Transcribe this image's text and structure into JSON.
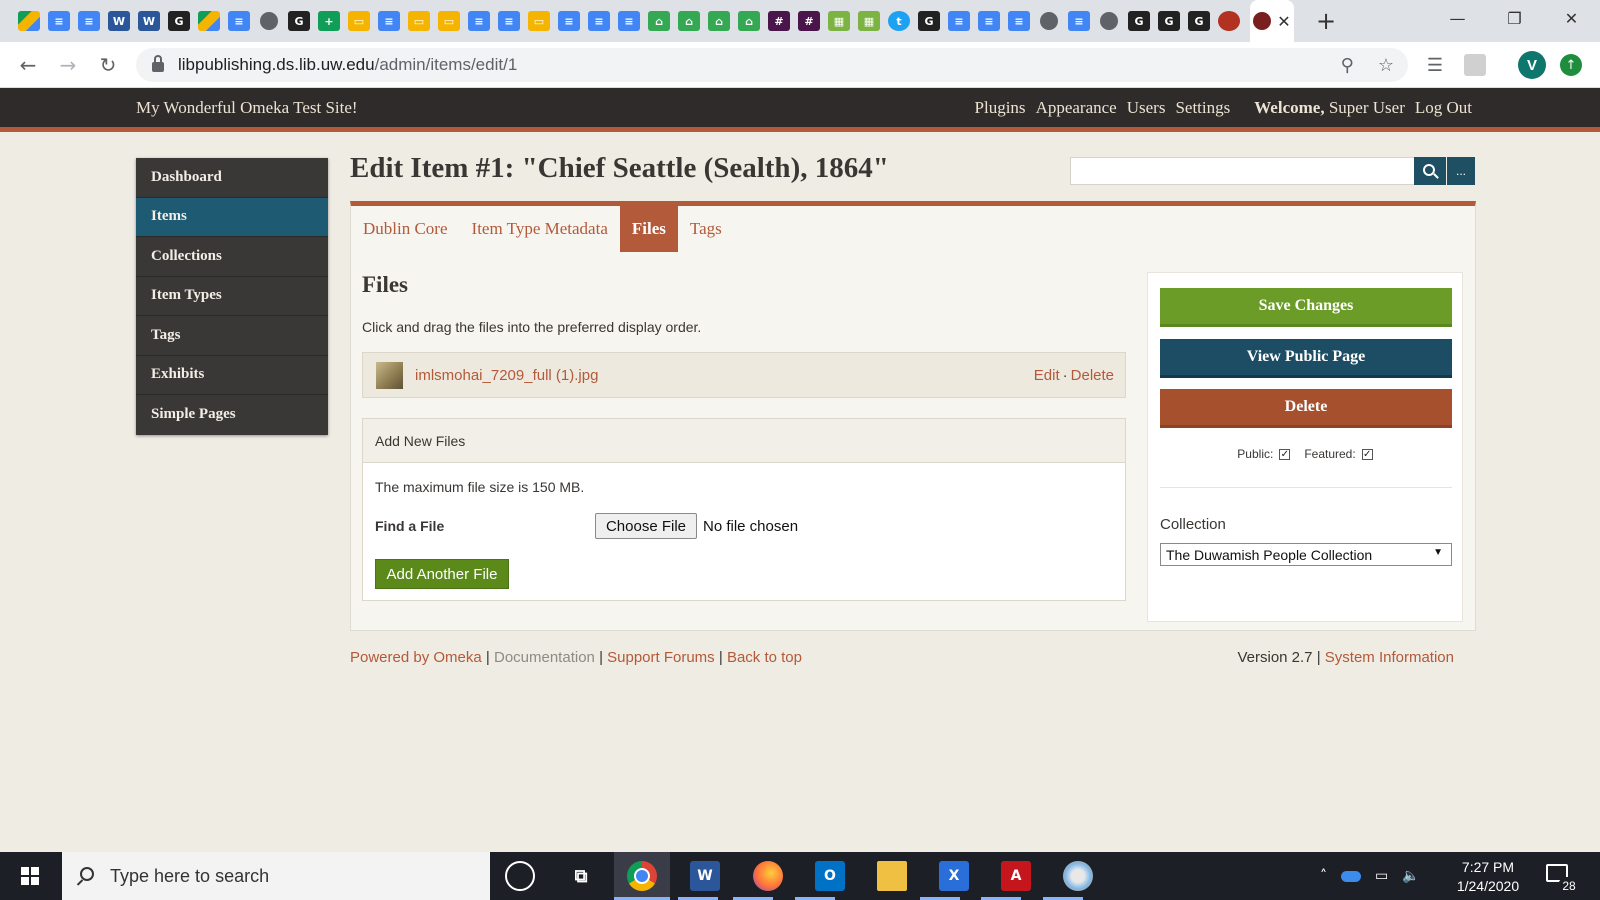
{
  "browser": {
    "address_domain": "libpublishing.ds.lib.uw.edu",
    "address_path": "/admin/items/edit/1",
    "profile_initial": "V",
    "pinned_tabs": [
      "drive",
      "doc",
      "doc",
      "word",
      "word",
      "dark",
      "drive",
      "doc",
      "globe",
      "dark",
      "sheet",
      "slide",
      "doc",
      "slide",
      "slide",
      "doc",
      "doc",
      "slide",
      "doc",
      "doc",
      "doc",
      "map",
      "map",
      "map",
      "map",
      "slack",
      "slack",
      "cal",
      "cal",
      "tw",
      "dark",
      "doc",
      "doc",
      "doc",
      "globe",
      "doc",
      "globe",
      "dark",
      "dark",
      "dark",
      "red"
    ]
  },
  "header": {
    "site_title": "My Wonderful Omeka Test Site!",
    "nav": [
      "Plugins",
      "Appearance",
      "Users",
      "Settings"
    ],
    "welcome_bold": "Welcome,",
    "user_name": "Super User",
    "logout": "Log Out"
  },
  "sidebar": {
    "items": [
      {
        "label": "Dashboard"
      },
      {
        "label": "Items"
      },
      {
        "label": "Collections"
      },
      {
        "label": "Item Types"
      },
      {
        "label": "Tags"
      },
      {
        "label": "Exhibits"
      },
      {
        "label": "Simple Pages"
      }
    ],
    "active": "Items"
  },
  "page": {
    "title": "Edit Item #1: \"Chief Seattle (Sealth), 1864\"",
    "search_adv_label": "..."
  },
  "tabs": [
    {
      "label": "Dublin Core"
    },
    {
      "label": "Item Type Metadata"
    },
    {
      "label": "Files"
    },
    {
      "label": "Tags"
    }
  ],
  "files": {
    "heading": "Files",
    "instruction": "Click and drag the files into the preferred display order.",
    "file_name": "imlsmohai_7209_full (1).jpg",
    "edit_label": "Edit",
    "delete_label": "Delete",
    "add_new_heading": "Add New Files",
    "max_size_text": "The maximum file size is 150 MB.",
    "find_label": "Find a File",
    "choose_label": "Choose File",
    "no_file_label": "No file chosen",
    "add_another_label": "Add Another File"
  },
  "actions": {
    "save_label": "Save Changes",
    "view_label": "View Public Page",
    "delete_label": "Delete",
    "public_label": "Public:",
    "featured_label": "Featured:",
    "collection_label": "Collection",
    "collection_value": "The Duwamish People Collection"
  },
  "footer": {
    "powered": "Powered by Omeka",
    "documentation": "Documentation",
    "forums": "Support Forums",
    "back_to_top": "Back to top",
    "version": "Version 2.7",
    "system_info": "System Information"
  },
  "taskbar": {
    "search_placeholder": "Type here to search",
    "time": "7:27 PM",
    "date": "1/24/2020",
    "notification_count": "28"
  },
  "colors": {
    "accent": "#b25a3a",
    "header_bg": "#2e2b2a",
    "sidebar_active": "#1f5a73",
    "save": "#6a9c27",
    "view": "#1c4d64",
    "delete": "#a6502e"
  }
}
